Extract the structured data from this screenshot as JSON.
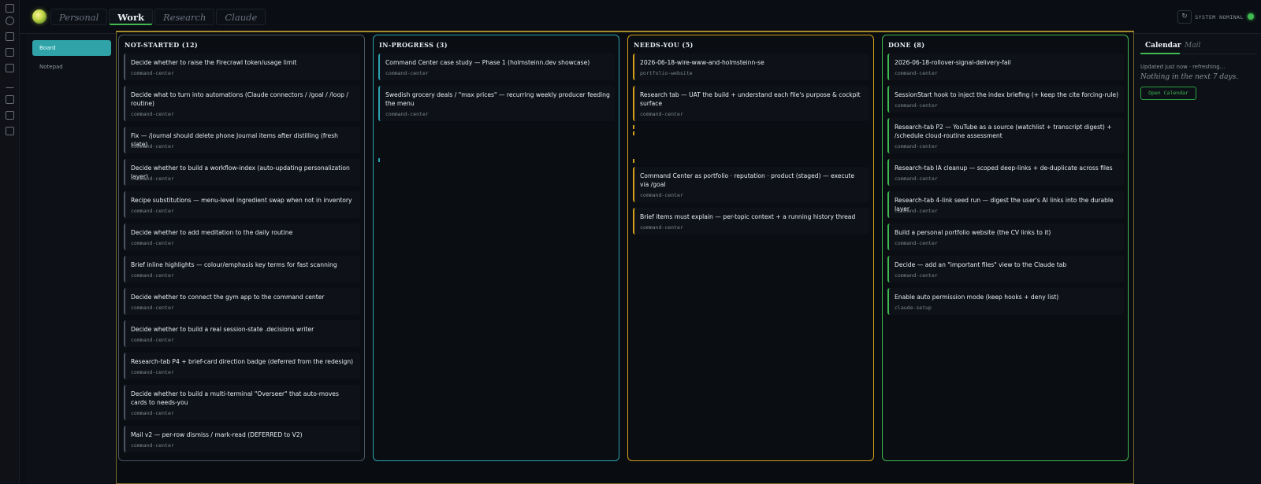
{
  "header": {
    "tabs": [
      {
        "label": "Personal",
        "active": false
      },
      {
        "label": "Work",
        "active": true
      },
      {
        "label": "Research",
        "active": false
      },
      {
        "label": "Claude",
        "active": false
      }
    ],
    "refresh_icon": "↻",
    "status_text": "SYSTEM NOMINAL",
    "status_color": "#3fb950"
  },
  "activity_bar": {
    "icons": [
      "file-icon",
      "branch-icon",
      "grid-icon",
      "calendar-icon",
      "copy-icon",
      "terminal-icon",
      "list-icon",
      "apps-icon",
      "image-icon"
    ]
  },
  "leftnav": {
    "items": [
      {
        "label": "Board",
        "active": true
      },
      {
        "label": "Notepad",
        "active": false
      }
    ]
  },
  "colors": {
    "not_started": "#6b7280",
    "in_progress": "#2aa4b0",
    "needs_you": "#d4a017",
    "done": "#3fb950"
  },
  "columns": [
    {
      "title": "NOT-STARTED (12)",
      "cards": [
        {
          "title": "Decide whether to raise the Firecrawl token/usage limit",
          "tag": "command-center"
        },
        {
          "title": "Decide what to turn into automations (Claude connectors / /goal / /loop / routine)",
          "tag": "command-center"
        },
        {
          "title": "Fix — /journal should delete phone Journal items after distilling (fresh slate)",
          "tag": "command-center"
        },
        {
          "title": "Decide whether to build a workflow-index (auto-updating personalization layer)",
          "tag": "command-center"
        },
        {
          "title": "Recipe substitutions — menu-level ingredient swap when not in inventory",
          "tag": "command-center"
        },
        {
          "title": "Decide whether to add meditation to the daily routine",
          "tag": "command-center"
        },
        {
          "title": "Brief inline highlights — colour/emphasis key terms for fast scanning",
          "tag": "command-center"
        },
        {
          "title": "Decide whether to connect the gym app to the command center",
          "tag": "command-center"
        },
        {
          "title": "Decide whether to build a real session-state .decisions writer",
          "tag": "command-center"
        },
        {
          "title": "Research-tab P4 + brief-card direction badge (deferred from the redesign)",
          "tag": "command-center"
        },
        {
          "title": "Decide whether to build a multi-terminal \"Overseer\" that auto-moves cards to needs-you",
          "tag": "command-center"
        },
        {
          "title": "Mail v2 — per-row dismiss / mark-read (DEFERRED to V2)",
          "tag": "command-center"
        }
      ]
    },
    {
      "title": "IN-PROGRESS (3)",
      "cards": [
        {
          "title": "Command Center case study — Phase 1 (holmsteinn.dev showcase)",
          "tag": "command-center"
        },
        {
          "title": "Swedish grocery deals / \"max prices\" — recurring weekly producer feeding the menu",
          "tag": "command-center"
        }
      ]
    },
    {
      "title": "NEEDS-YOU (5)",
      "cards": [
        {
          "title": "2026-06-18-wire-www-and-holmsteinn-se",
          "tag": "portfolio-website"
        },
        {
          "title": "Research tab — UAT the build + understand each file's purpose & cockpit surface",
          "tag": "command-center"
        },
        {
          "title": "Command Center as portfolio · reputation · product (staged) — execute via /goal",
          "tag": "command-center"
        },
        {
          "title": "Brief items must explain — per-topic context + a running history thread",
          "tag": "command-center"
        }
      ]
    },
    {
      "title": "DONE (8)",
      "cards": [
        {
          "title": "2026-06-18-rollover-signal-delivery-fail",
          "tag": "command-center"
        },
        {
          "title": "SessionStart hook to inject the index briefing (+ keep the cite forcing-rule)",
          "tag": "command-center"
        },
        {
          "title": "Research-tab P2 — YouTube as a source (watchlist + transcript digest) + /schedule cloud-routine assessment",
          "tag": "command-center"
        },
        {
          "title": "Research-tab IA cleanup — scoped deep-links + de-duplicate across files",
          "tag": "command-center"
        },
        {
          "title": "Research-tab 4-link seed run — digest the user's AI links into the durable layer",
          "tag": "command-center"
        },
        {
          "title": "Build a personal portfolio website (the CV links to it)",
          "tag": "command-center"
        },
        {
          "title": "Decide — add an \"important files\" view to the Claude tab",
          "tag": "command-center"
        },
        {
          "title": "Enable auto permission mode (keep hooks + deny list)",
          "tag": "claude-setup"
        }
      ]
    }
  ],
  "rpanel": {
    "tabs": [
      {
        "label": "Calendar",
        "active": true
      },
      {
        "label": "Mail",
        "active": false
      }
    ],
    "updated": "Updated just now · refreshing…",
    "nothing": "Nothing in the next 7 days.",
    "open_button": "Open Calendar"
  }
}
